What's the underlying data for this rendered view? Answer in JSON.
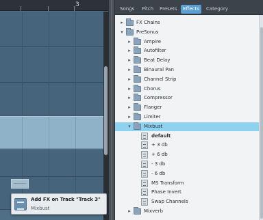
{
  "arrange": {
    "ruler_bar": "3",
    "tooltip": {
      "title": "Add FX on Track \"Track 3\"",
      "subtitle": "Mixbust"
    }
  },
  "browser": {
    "tabs": [
      {
        "label": "Songs"
      },
      {
        "label": "Pitch"
      },
      {
        "label": "Presets"
      },
      {
        "label": "Effects",
        "active": true
      },
      {
        "label": "Category"
      }
    ],
    "tree": [
      {
        "label": "FX Chains",
        "icon": "folder-icon",
        "arrow": "+"
      },
      {
        "label": "PreSonus",
        "icon": "folder-icon",
        "arrow": "-"
      },
      {
        "label": "Ampire",
        "icon": "folder-icon",
        "arrow": "+"
      },
      {
        "label": "Autofilter",
        "icon": "folder-icon",
        "arrow": "+"
      },
      {
        "label": "Beat Delay",
        "icon": "folder-icon",
        "arrow": "+"
      },
      {
        "label": "Binaural Pan",
        "icon": "folder-icon",
        "arrow": "+"
      },
      {
        "label": "Channel Strip",
        "icon": "folder-icon",
        "arrow": "+"
      },
      {
        "label": "Chorus",
        "icon": "folder-icon",
        "arrow": "+"
      },
      {
        "label": "Compressor",
        "icon": "folder-icon",
        "arrow": "+"
      },
      {
        "label": "Flanger",
        "icon": "folder-icon",
        "arrow": "+"
      },
      {
        "label": "Limiter",
        "icon": "folder-icon",
        "arrow": "+"
      },
      {
        "label": "Mixbust",
        "icon": "folder-icon",
        "arrow": "-",
        "selected": true
      },
      {
        "label": "default",
        "icon": "preset-icon",
        "bold": true
      },
      {
        "label": "+ 3 db",
        "icon": "preset-icon"
      },
      {
        "label": "+ 6 db",
        "icon": "preset-icon"
      },
      {
        "label": "- 3 db",
        "icon": "preset-icon"
      },
      {
        "label": "- 6 db",
        "icon": "preset-icon"
      },
      {
        "label": "MS Transform",
        "icon": "preset-icon"
      },
      {
        "label": "Phase Invert",
        "icon": "preset-icon"
      },
      {
        "label": "Swap Channels",
        "icon": "preset-icon"
      },
      {
        "label": "Mixverb",
        "icon": "folder-icon",
        "arrow": "+"
      }
    ]
  }
}
